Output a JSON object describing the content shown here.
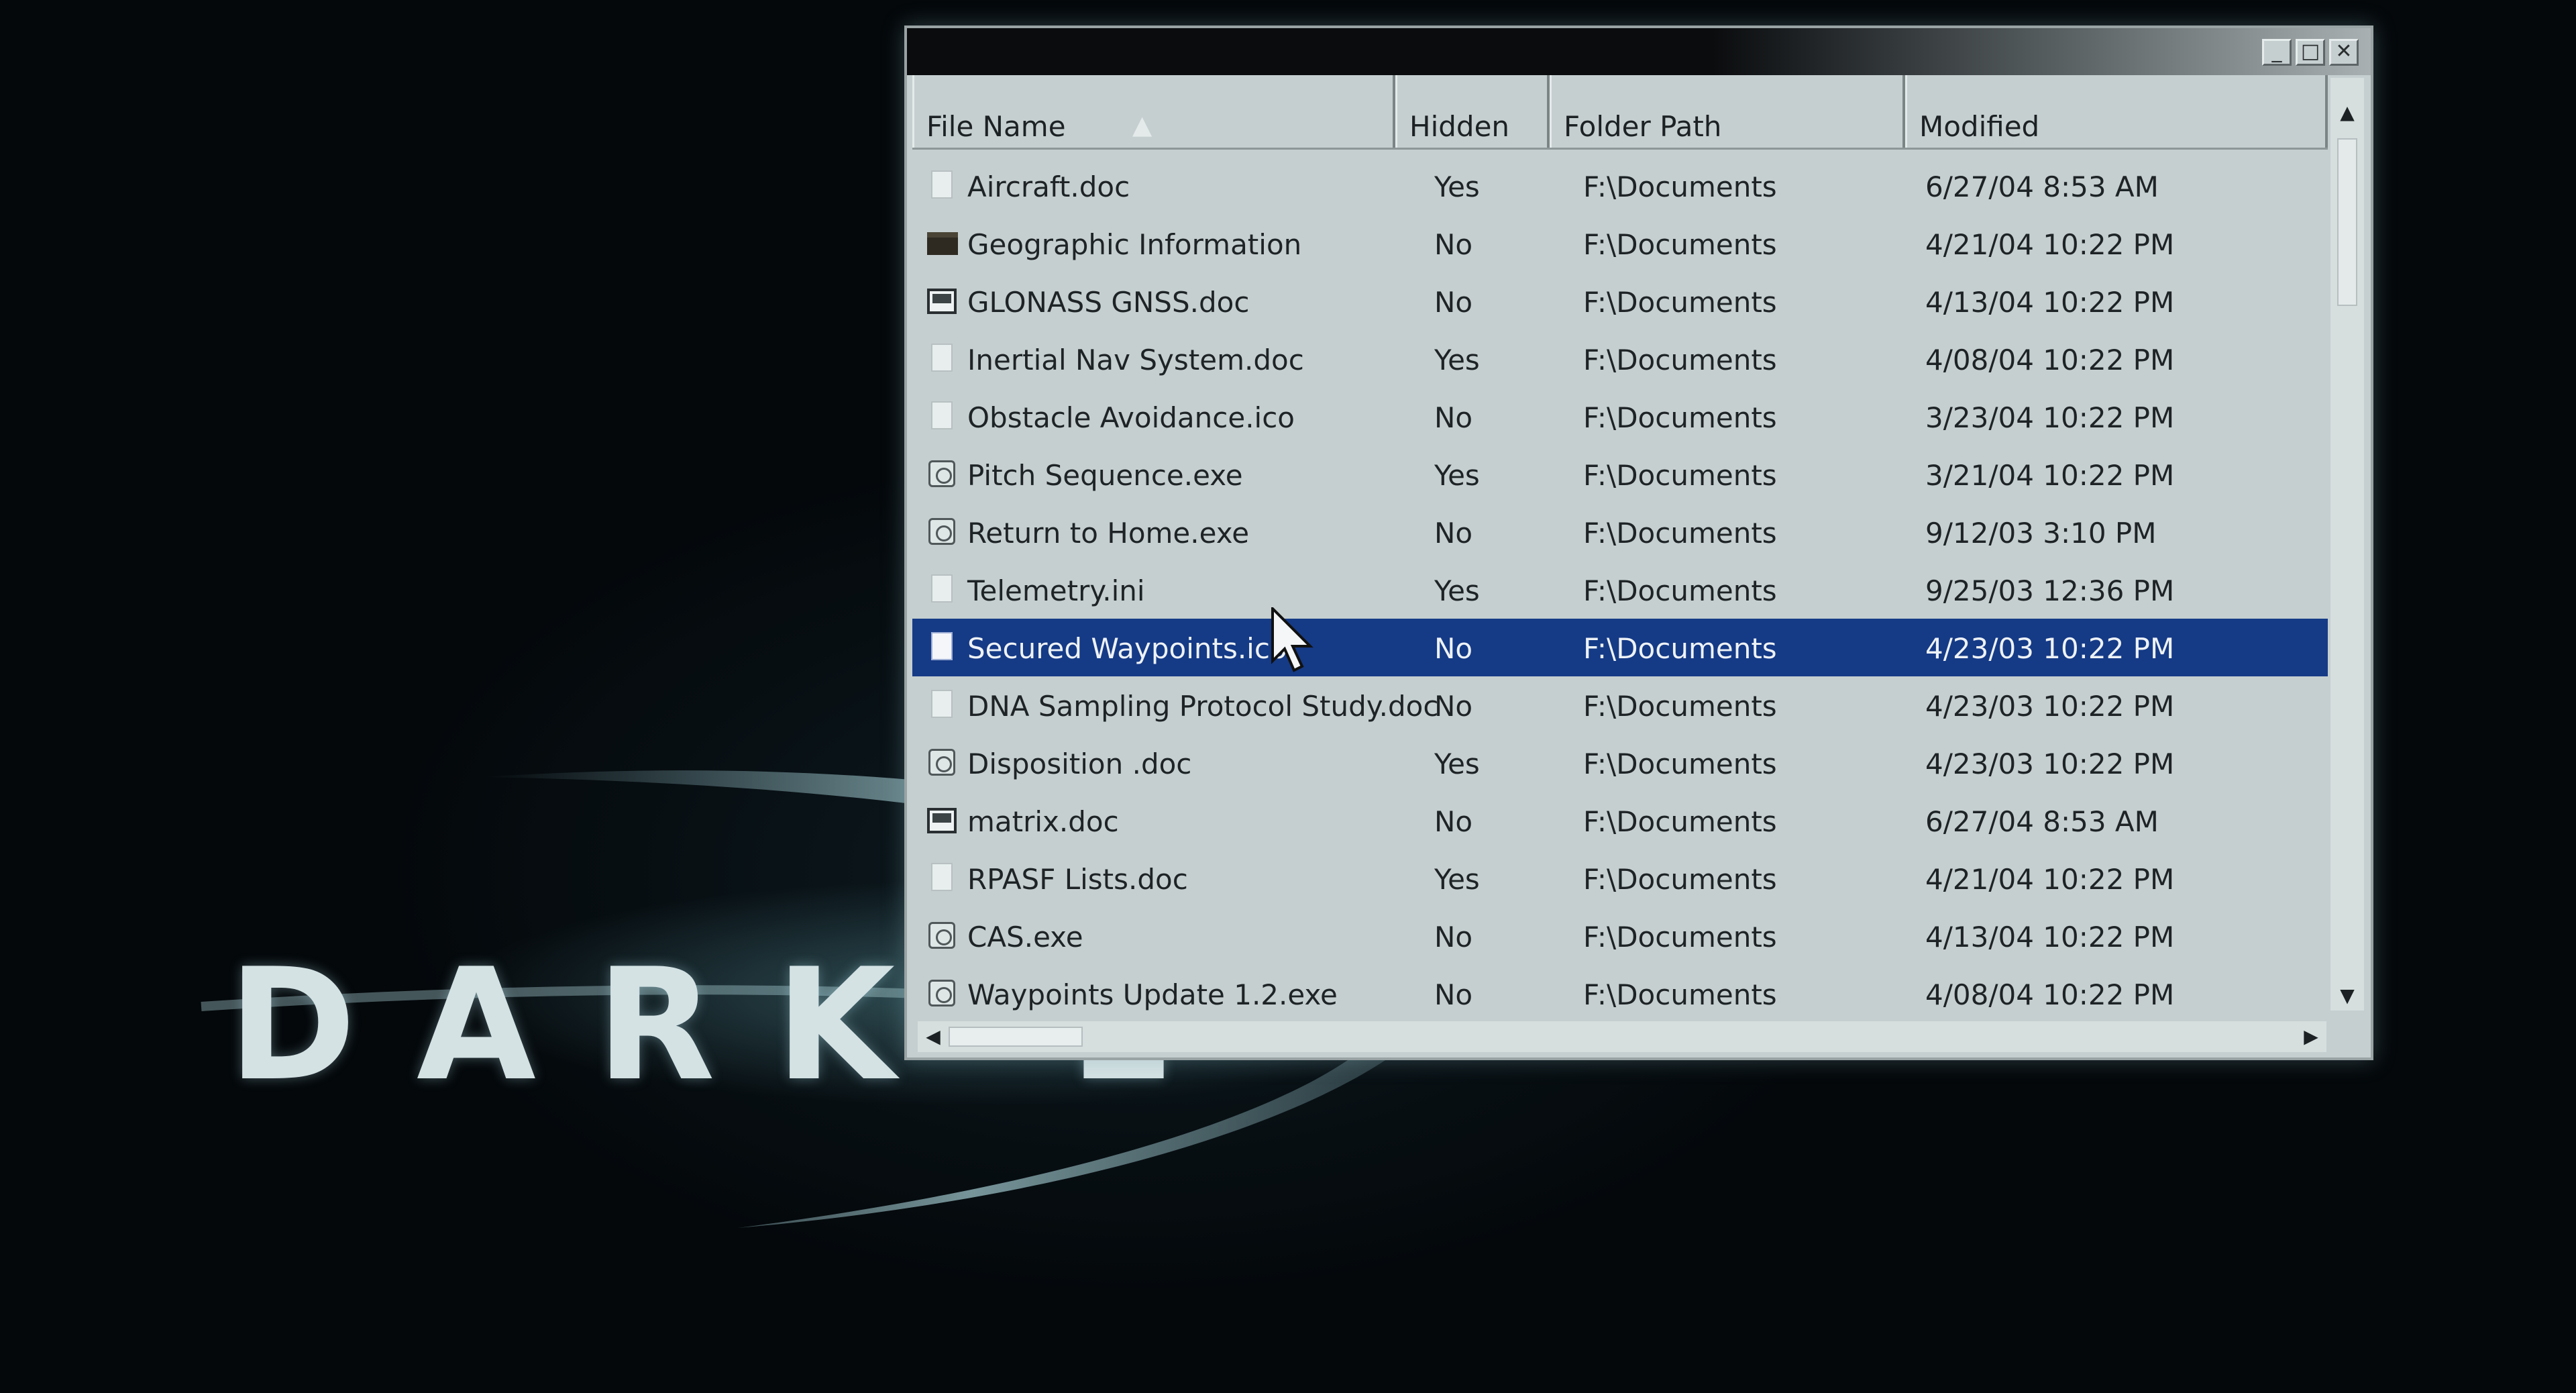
{
  "branding": {
    "logo_text": "DARK L"
  },
  "window": {
    "controls": {
      "minimize": "_",
      "maximize": "□",
      "close": "✕"
    }
  },
  "columns": {
    "name": "File Name",
    "hidden": "Hidden",
    "path": "Folder Path",
    "modified": "Modified",
    "sort_indicator": "▲"
  },
  "selected_index": 8,
  "files": [
    {
      "icon": "document-icon",
      "name": "Aircraft.doc",
      "hidden": "Yes",
      "path": "F:\\Documents",
      "modified": "6/27/04 8:53 AM"
    },
    {
      "icon": "folder-icon",
      "name": "Geographic Information",
      "hidden": "No",
      "path": "F:\\Documents",
      "modified": "4/21/04 10:22 PM"
    },
    {
      "icon": "image-icon",
      "name": "GLONASS GNSS.doc",
      "hidden": "No",
      "path": "F:\\Documents",
      "modified": "4/13/04 10:22 PM"
    },
    {
      "icon": "document-icon",
      "name": "Inertial Nav System.doc",
      "hidden": "Yes",
      "path": "F:\\Documents",
      "modified": "4/08/04 10:22 PM"
    },
    {
      "icon": "document-icon",
      "name": "Obstacle Avoidance.ico",
      "hidden": "No",
      "path": "F:\\Documents",
      "modified": "3/23/04 10:22 PM"
    },
    {
      "icon": "executable-icon",
      "name": "Pitch Sequence.exe",
      "hidden": "Yes",
      "path": "F:\\Documents",
      "modified": "3/21/04 10:22 PM"
    },
    {
      "icon": "executable-icon",
      "name": "Return to Home.exe",
      "hidden": "No",
      "path": "F:\\Documents",
      "modified": "9/12/03 3:10 PM"
    },
    {
      "icon": "document-icon",
      "name": "Telemetry.ini",
      "hidden": "Yes",
      "path": "F:\\Documents",
      "modified": "9/25/03 12:36 PM"
    },
    {
      "icon": "document-icon",
      "name": "Secured Waypoints.ico",
      "hidden": "No",
      "path": "F:\\Documents",
      "modified": "4/23/03 10:22 PM"
    },
    {
      "icon": "document-icon",
      "name": "DNA Sampling Protocol Study.doc",
      "hidden": "No",
      "path": "F:\\Documents",
      "modified": "4/23/03 10:22 PM"
    },
    {
      "icon": "executable-icon",
      "name": "Disposition .doc",
      "hidden": "Yes",
      "path": "F:\\Documents",
      "modified": "4/23/03 10:22 PM"
    },
    {
      "icon": "image-icon",
      "name": "matrix.doc",
      "hidden": "No",
      "path": "F:\\Documents",
      "modified": "6/27/04 8:53 AM"
    },
    {
      "icon": "document-icon",
      "name": "RPASF Lists.doc",
      "hidden": "Yes",
      "path": "F:\\Documents",
      "modified": "4/21/04 10:22 PM"
    },
    {
      "icon": "executable-icon",
      "name": "CAS.exe",
      "hidden": "No",
      "path": "F:\\Documents",
      "modified": "4/13/04 10:22 PM"
    },
    {
      "icon": "executable-icon",
      "name": "Waypoints Update 1.2.exe",
      "hidden": "No",
      "path": "F:\\Documents",
      "modified": "4/08/04 10:22 PM"
    }
  ],
  "scrollbars": {
    "up": "▲",
    "down": "▼",
    "left": "◀",
    "right": "▶"
  },
  "colors": {
    "selection": "#153a86",
    "window_bg": "#c6cfd0"
  }
}
